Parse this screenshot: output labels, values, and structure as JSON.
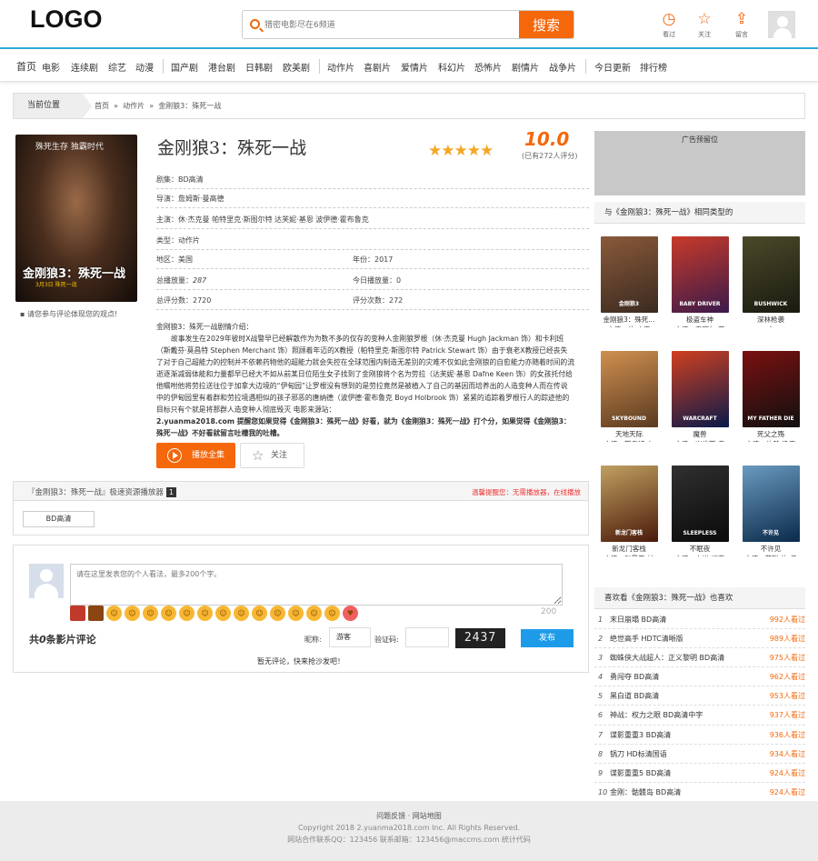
{
  "header": {
    "logo": "LOGO",
    "search_placeholder": "猎密电影尽在6频道",
    "search_button": "搜索",
    "icons": [
      {
        "icon": "history-icon",
        "label": "看过"
      },
      {
        "icon": "star-icon",
        "label": "关注"
      },
      {
        "icon": "upload-icon",
        "label": "留言"
      }
    ]
  },
  "nav": {
    "items": [
      "首页",
      "电影",
      "连续剧",
      "综艺",
      "动漫",
      "国产剧",
      "港台剧",
      "日韩剧",
      "欧美剧",
      "动作片",
      "喜剧片",
      "爱情片",
      "科幻片",
      "恐怖片",
      "剧情片",
      "战争片",
      "今日更新",
      "排行榜"
    ]
  },
  "breadcrumb": {
    "current_label": "当前位置",
    "home": "首页",
    "sep": "»",
    "category": "动作片",
    "title": "金刚狼3：殊死一战"
  },
  "movie": {
    "poster_tagline": "殊死生存 独霸时代",
    "poster_title": "金刚狼3：殊死一战",
    "poster_date": "3月3日 殊死一战",
    "comment_hint": "请您参与评论体现您的观点!",
    "title": "金刚狼3：殊死一战",
    "stars": "★★★★★",
    "score": "10.0",
    "score_count": "(已有272人评分)",
    "info": {
      "drama": "剧集：BD高清",
      "director": "导演：詹姆斯·曼高德",
      "cast": "主演：休·杰克曼 帕特里克·斯图尔特 达芙妮·基恩 波伊德·霍布鲁克",
      "type": "类型：动作片",
      "region": "地区：美国",
      "year": "年份：2017",
      "total_plays_label": "总播放量：",
      "total_plays": "287",
      "today_plays": "今日播放量：0",
      "total_score": "总评分数：2720",
      "score_times": "评分次数：272"
    },
    "synopsis_title": "金刚狼3：殊死一战剧情介绍：",
    "synopsis_body": "故事发生在2029年彼时X战警早已经解散作为为数不多的仅存的变种人金刚狼罗根（休·杰克曼 Hugh Jackman 饰）和卡利班（斯戴芬·莫昌特 Stephen Merchant 饰）照顾着年迈的X教授（帕特里克·斯图尔特 Patrick Stewart 饰）由于衰老X教授已经丧失了对于自己超能力的控制并不依赖药物他的超能力就会失控在全球范围内制造无差别的灾难不仅如此金刚狼的自愈能力亦随着时间的流逝逐渐减弱体能和力量都早已经大不如从前某日位陌生女子找到了金刚狼将个名为劳拉（达芙妮·基恩 Dafne Keen 饰）的女孩托付给他嘱咐他将劳拉送往位于加拿大边境的“伊甸园”让罗根没有想到的是劳拉竟然是被植入了自己的基因而培养出的人造变种人而在传说中的伊甸园里有着群和劳拉境遇相似的孩子邪恶的唐纳德（波伊德·霍布鲁克 Boyd Holbrook 饰）紧紧的追踪着罗根行人的踪迹他的目标只有个就是将那群人造变种人彻底毁灭 电影来源站：",
    "synopsis_tail": "2.yuanma2018.com 提醒您如果觉得《金刚狼3：殊死一战》好看，就为《金刚狼3：殊死一战》打个分，如果觉得《金刚狼3：殊死一战》不好看就留言吐槽我的吐槽。",
    "play_button": "播放全集",
    "follow_button": "关注"
  },
  "player": {
    "title": "『金刚狼3：殊死一战』极速资源播放器",
    "count": "1",
    "warning": "温馨提醒您：无需播放器，在线播放",
    "episode": "BD高清"
  },
  "comments": {
    "placeholder": "请在这里发表您的个人看法，最多200个字。",
    "char_count": "200",
    "total_prefix": "共",
    "total_num": "0",
    "total_suffix": "条影片评论",
    "nick_label": "昵称:",
    "nick_value": "游客",
    "captcha_label": "验证码:",
    "captcha_text": "2437",
    "submit": "发布",
    "empty": "暂无评论，快来抢沙发吧！"
  },
  "sidebar": {
    "ad_label": "广告预留位",
    "related_title": "与《金刚狼3：殊死一战》相同类型的",
    "related": [
      {
        "name": "金刚狼3：殊死...",
        "actors": "主演：休·杰克",
        "colors": [
          "#3a2a20",
          "#8a5a3a"
        ],
        "poster_text": "金刚狼3"
      },
      {
        "name": "极盗车神",
        "actors": "主演：安塞尔·艾",
        "colors": [
          "#3b1a4a",
          "#c83a2a"
        ],
        "poster_text": "BABY DRIVER"
      },
      {
        "name": "深林枪袭",
        "actors": "主",
        "colors": [
          "#1a1a10",
          "#4a4a2a"
        ],
        "poster_text": "BUSHWICK"
      },
      {
        "name": "天地天际",
        "actors": "主演：斯考特·布",
        "colors": [
          "#5a3a20",
          "#d09050"
        ],
        "poster_text": "SKYBOUND"
      },
      {
        "name": "魔兽",
        "actors": "主演：崔维斯·费",
        "colors": [
          "#0a1a4a",
          "#d04020"
        ],
        "poster_text": "WARCRAFT"
      },
      {
        "name": "死父之殇",
        "actors": "主演：约翰·逸李",
        "colors": [
          "#101010",
          "#7a1010"
        ],
        "poster_text": "MY FATHER DIE"
      },
      {
        "name": "新龙门客栈",
        "actors": "主演：张曼玉 林",
        "colors": [
          "#4a1a0a",
          "#c0a060"
        ],
        "poster_text": "新龙门客栈"
      },
      {
        "name": "不眠夜",
        "actors": "主演：杰米·福克",
        "colors": [
          "#0a0a0a",
          "#303030"
        ],
        "poster_text": "SLEEPLESS"
      },
      {
        "name": "不许见",
        "actors": "主演：薛聪·沈 任",
        "colors": [
          "#0a2a4a",
          "#6a9ac0"
        ],
        "poster_text": "不许见"
      }
    ],
    "also_title": "喜欢看《金刚狼3：殊死一战》也喜欢",
    "also": [
      {
        "no": "1",
        "name": "末日崩塌 BD高清",
        "views": "992人看过"
      },
      {
        "no": "2",
        "name": "绝世高手 HDTC清晰版",
        "views": "989人看过"
      },
      {
        "no": "3",
        "name": "蜘蛛侠大战超人：正义黎明 BD高清",
        "views": "975人看过"
      },
      {
        "no": "4",
        "name": "勇闯夺 BD高清",
        "views": "962人看过"
      },
      {
        "no": "5",
        "name": "黑白道 BD高清",
        "views": "953人看过"
      },
      {
        "no": "6",
        "name": "神战：权力之眼 BD高清中字",
        "views": "937人看过"
      },
      {
        "no": "7",
        "name": "谍影重重3 BD高清",
        "views": "936人看过"
      },
      {
        "no": "8",
        "name": "锅刀 HD标清国语",
        "views": "934人看过"
      },
      {
        "no": "9",
        "name": "谍影重重5 BD高清",
        "views": "924人看过"
      },
      {
        "no": "10",
        "name": "金刚：骷髅岛 BD高清",
        "views": "924人看过"
      }
    ]
  },
  "footer": {
    "links": "问题反馈 · 网站地图",
    "copyright": "Copyright 2018 2.yuanma2018.com Inc. All Rights Reserved.",
    "contact": "网站合作联系QQ：123456 联系邮箱：123456@maccms.com 统计代码"
  },
  "colors": {
    "accent": "#f4670b",
    "link_blue": "#2eaadc",
    "submit_blue": "#1e9be8"
  }
}
